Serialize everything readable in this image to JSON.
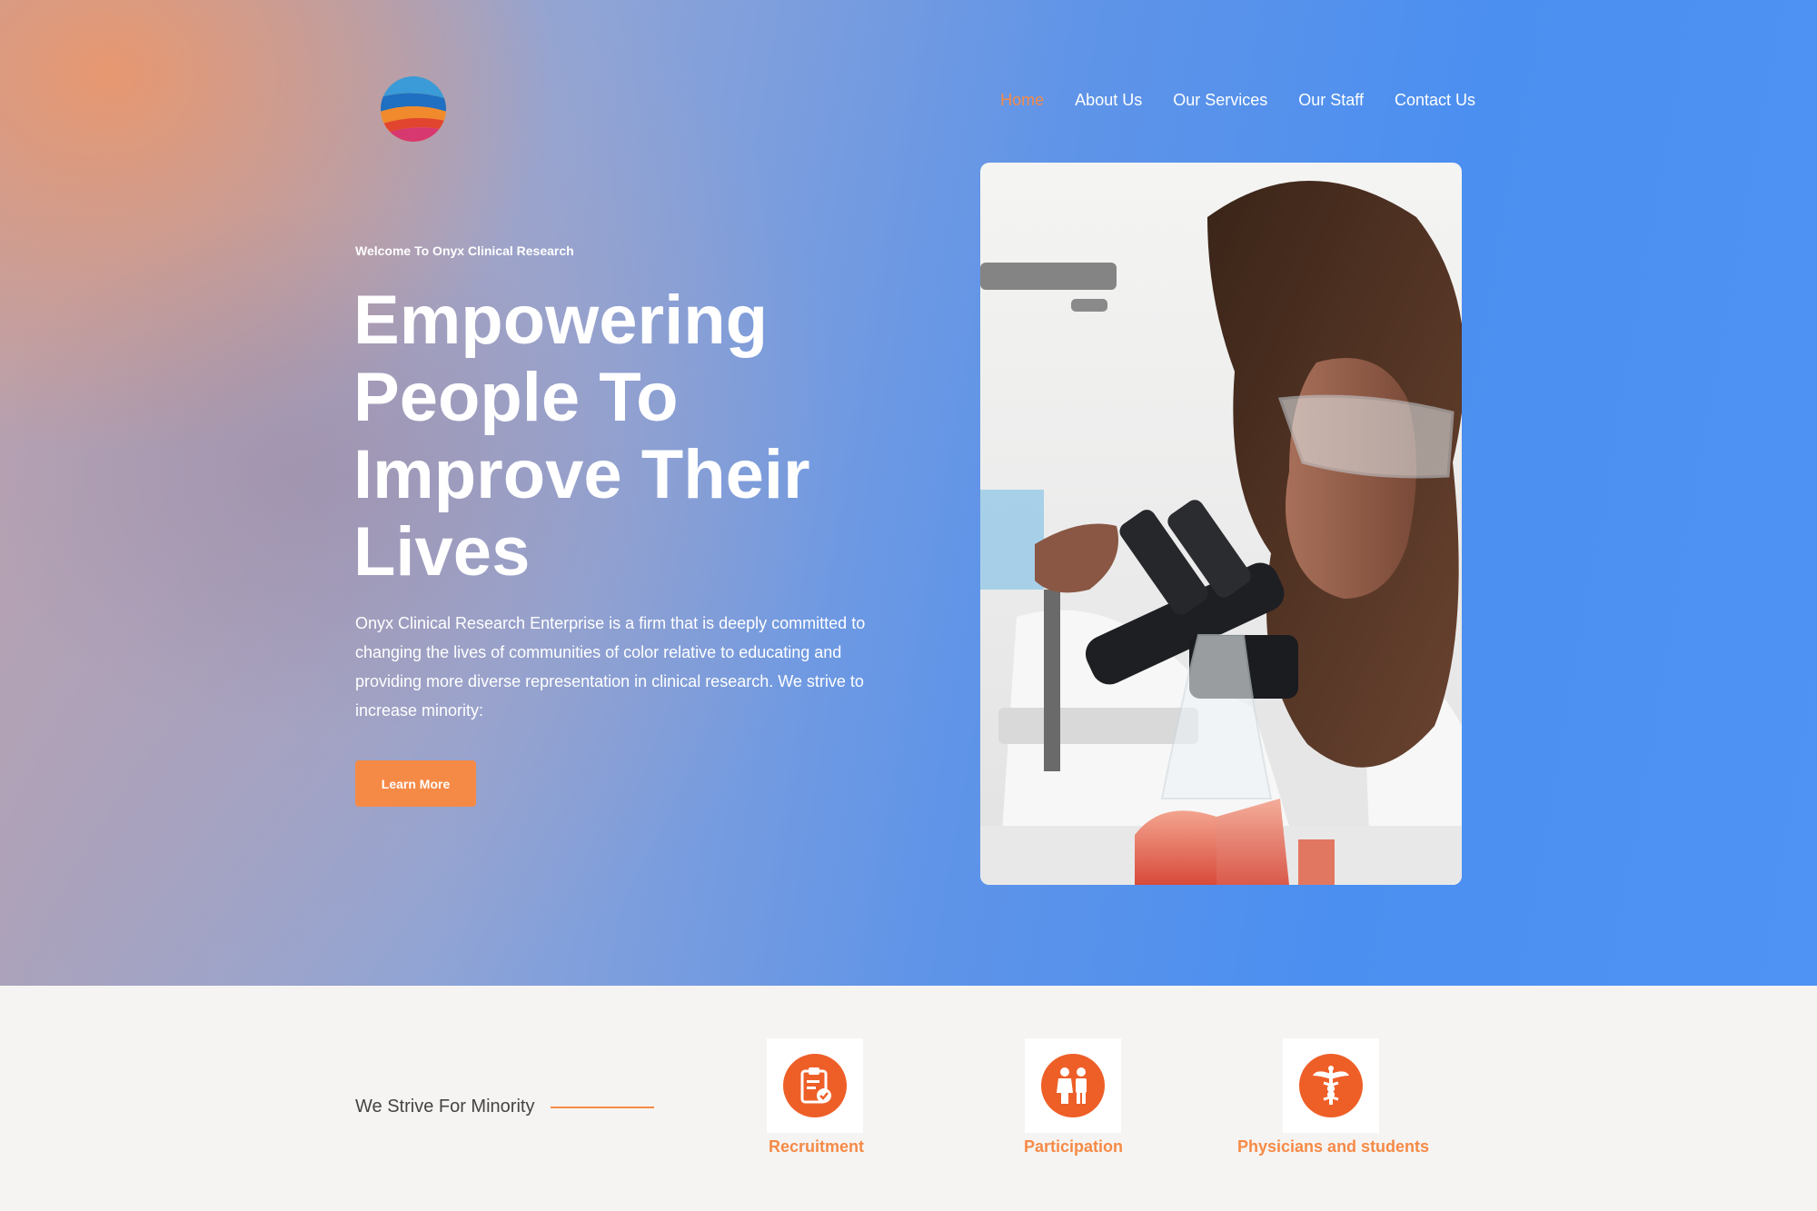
{
  "nav": {
    "items": [
      {
        "label": "Home",
        "active": true
      },
      {
        "label": "About Us",
        "active": false
      },
      {
        "label": "Our Services",
        "active": false
      },
      {
        "label": "Our Staff",
        "active": false
      },
      {
        "label": "Contact Us",
        "active": false
      }
    ]
  },
  "hero": {
    "welcome": "Welcome To Onyx Clinical Research",
    "headline": "Empowering People To Improve Their Lives",
    "intro": "Onyx Clinical Research Enterprise is a firm that is deeply committed to changing the lives of communities of color relative to educating and providing more diverse representation in clinical research. We strive to increase minority:",
    "cta_label": "Learn More"
  },
  "strip": {
    "heading": "We Strive For Minority",
    "features": [
      {
        "label": "Recruitment",
        "icon": "clipboard-check-icon"
      },
      {
        "label": "Participation",
        "icon": "people-icon"
      },
      {
        "label": "Physicians and students",
        "icon": "caduceus-icon"
      }
    ]
  },
  "colors": {
    "accent": "#f58a46",
    "icon_circle": "#ee5f28",
    "hero_blue": "#4b8ff0"
  }
}
